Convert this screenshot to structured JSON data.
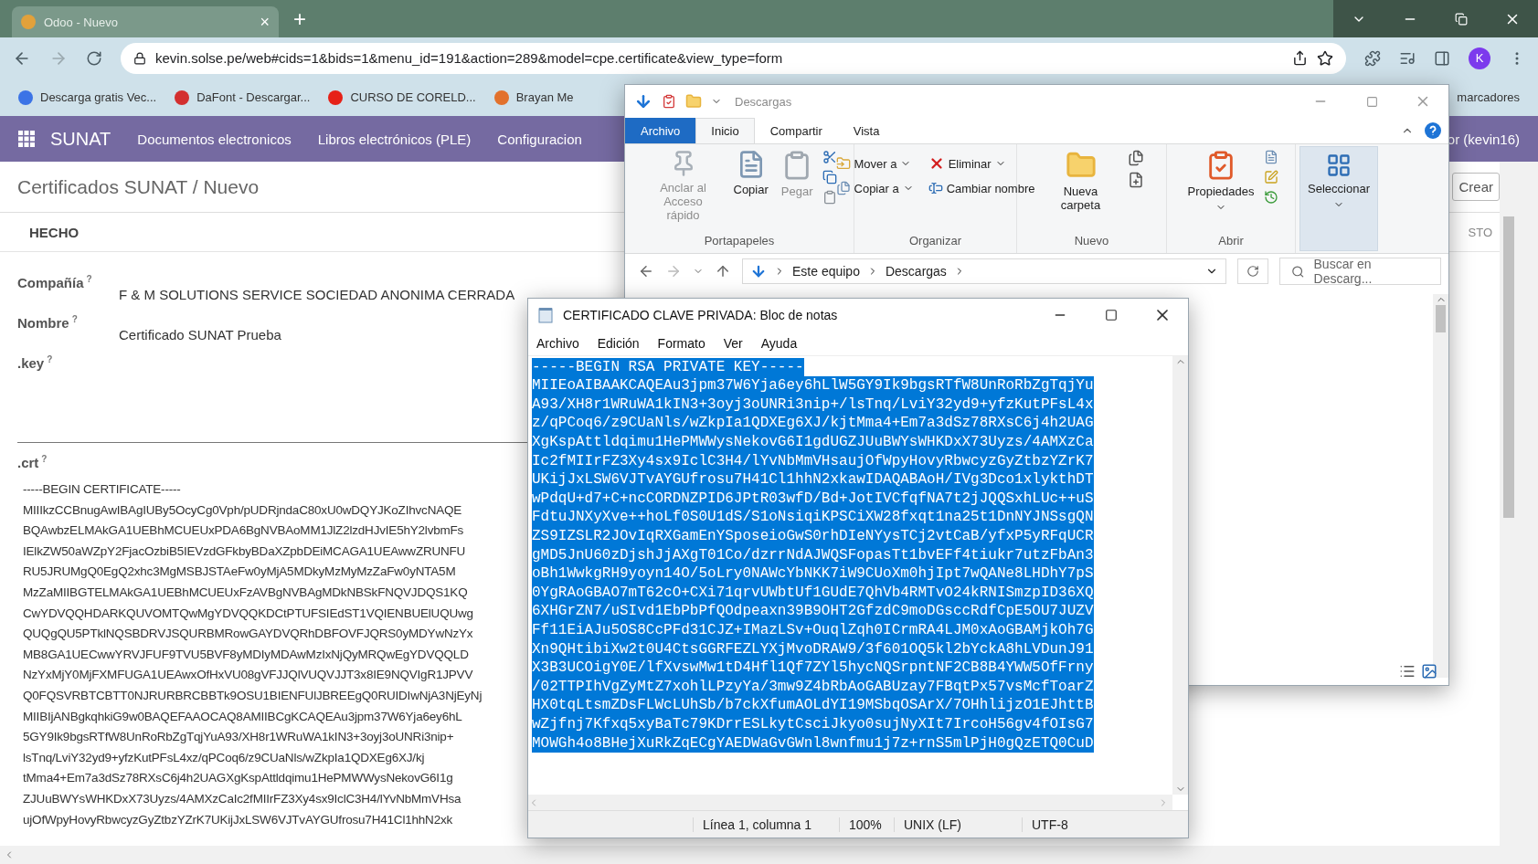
{
  "browser": {
    "tab_title": "Odoo - Nuevo",
    "tab_close": "×",
    "new_tab": "+",
    "url": "kevin.solse.pe/web#cids=1&bids=1&menu_id=191&action=289&model=cpe.certificate&view_type=form",
    "profile_initial": "K",
    "bookmarks": [
      {
        "label": "Descarga gratis Vec..."
      },
      {
        "label": "DaFont - Descargar..."
      },
      {
        "label": "CURSO DE CORELD..."
      },
      {
        "label": "Brayan Me"
      }
    ],
    "bookmarks_folder": "marcadores"
  },
  "odoo": {
    "app": "SUNAT",
    "menu": [
      "Documentos electronicos",
      "Libros electrónicos (PLE)",
      "Configuracion"
    ],
    "user": "or (kevin16)",
    "breadcrumb": "Certificados SUNAT / Nuevo",
    "create_button": "Crear",
    "status": "HECHO",
    "status_right": "STO",
    "fields": [
      {
        "label": "Compañía",
        "help": "?",
        "value": "F & M SOLUTIONS SERVICE SOCIEDAD ANONIMA CERRADA"
      },
      {
        "label": "Nombre",
        "help": "?",
        "value": "Certificado SUNAT Prueba"
      },
      {
        "label": ".key",
        "help": "?"
      }
    ],
    "crt": {
      "label": ".crt",
      "help": "?",
      "lines": [
        "-----BEGIN CERTIFICATE-----",
        "MIIIkzCCBnugAwIBAgIUBy5OcyCg0Vph/pUDRjndaC80xU0wDQYJKoZIhvcNAQE",
        "BQAwbzELMAkGA1UEBhMCUEUxPDA6BgNVBAoMM1JlZ2lzdHJvIE5hY2lvbmFs",
        "IElkZW50aWZpY2FjacOzbiB5IEVzdGFkbyBDaXZpbDEiMCAGA1UEAwwZRUNFU",
        "RU5JRUMgQ0EgQ2xhc3MgMSBJSTAeFw0yMjA5MDkyMzMyMzZaFw0yNTA5M",
        "MzZaMIIBGTELMAkGA1UEBhMCUEUxFzAVBgNVBAgMDkNBSkFNQVJDQS1KQ",
        "CwYDVQQHDARKQUVOMTQwMgYDVQQKDCtPTUFSIEdST1VQIENBUElUQUwg",
        "QUQgQU5PTklNQSBDRVJSQURBMRowGAYDVQRhDBFOVFJQRS0yMDYwNzYx",
        "MB8GA1UECwwYRVJFUF9TVU5BVF8yMDIyMDAwMzIxNjQyMRQwEgYDVQQLD",
        "NzYxMjY0MjFXMFUGA1UEAwxOfHxVU08gVFJJQlVUQVJJT3x8IE9NQVIgR1JPVV",
        "Q0FQSVRBTCBTT0NJRURBRCBBTk9OSU1BIENFUlJBREEgQ0RUIDIwNjA3NjEyNj",
        "MIIBIjANBgkqhkiG9w0BAQEFAAOCAQ8AMIIBCgKCAQEAu3jpm37W6Yja6ey6hL",
        "5GY9Ik9bgsRTfW8UnRoRbZgTqjYuA93/XH8r1WRuWA1kIN3+3oyj3oUNRi3nip+",
        "lsTnq/LviY32yd9+yfzKutPFsL4xz/qPCoq6/z9CUaNls/wZkpIa1QDXEg6XJ/kj",
        "tMma4+Em7a3dSz78RXsC6j4h2UAGXgKspAttldqimu1HePMWWysNekovG6I1g",
        "ZJUuBWYsWHKDxX73Uyzs/4AMXzCaIc2fMIIrFZ3Xy4sx9IclC3H4/lYvNbMmVHsa",
        "ujOfWpyHovyRbwcyzGyZtbzYZrK7UKijJxLSW6VJTvAYGUfrosu7H41Cl1hhN2xk"
      ]
    }
  },
  "explorer": {
    "title": "Descargas",
    "tabs": [
      {
        "label": "Archivo",
        "kind": "file",
        "selected": false
      },
      {
        "label": "Inicio",
        "kind": "tab",
        "selected": true
      },
      {
        "label": "Compartir",
        "kind": "tab",
        "selected": false
      },
      {
        "label": "Vista",
        "kind": "tab",
        "selected": false
      }
    ],
    "ribbon": [
      {
        "label": "Portapapeles",
        "items": [
          {
            "label": "Anclar al Acceso rápido",
            "disabled": true
          },
          {
            "label": "Copiar",
            "disabled": false
          },
          {
            "label": "Pegar",
            "disabled": true
          }
        ]
      },
      {
        "label": "Organizar",
        "items": [
          {
            "label": "Mover a"
          },
          {
            "label": "Copiar a"
          },
          {
            "label": "Eliminar"
          },
          {
            "label": "Cambiar nombre"
          }
        ]
      },
      {
        "label": "Nuevo",
        "items": [
          {
            "label": "Nueva carpeta"
          }
        ]
      },
      {
        "label": "Abrir",
        "items": [
          {
            "label": "Propiedades"
          }
        ]
      }
    ],
    "select_button": "Seleccionar",
    "path": [
      "Este equipo",
      "Descargas"
    ],
    "search_placeholder": "Buscar en Descarg..."
  },
  "notepad": {
    "title": "CERTIFICADO CLAVE PRIVADA: Bloc de notas",
    "menu": [
      "Archivo",
      "Edición",
      "Formato",
      "Ver",
      "Ayuda"
    ],
    "selected": true,
    "lines": [
      "-----BEGIN RSA PRIVATE KEY-----",
      "MIIEoAIBAAKCAQEAu3jpm37W6Yja6ey6hLlW5GY9Ik9bgsRTfW8UnRoRbZgTqjYu",
      "A93/XH8r1WRuWA1kIN3+3oyj3oUNRi3nip+/lsTnq/LviY32yd9+yfzKutPFsL4x",
      "z/qPCoq6/z9CUaNls/wZkpIa1QDXEg6XJ/kjtMma4+Em7a3dSz78RXsC6j4h2UAG",
      "XgKspAttldqimu1HePMWWysNekovG6I1gdUGZJUuBWYsWHKDxX73Uyzs/4AMXzCa",
      "Ic2fMIIrFZ3Xy4sx9IclC3H4/lYvNbMmVHsaujOfWpyHovyRbwcyzGyZtbzYZrK7",
      "UKijJxLSW6VJTvAYGUfrosu7H41Cl1hhN2xkawIDAQABAoH/IVg3Dco1xlykthDT",
      "wPdqU+d7+C+ncCORDNZPID6JPtR03wfD/Bd+JotIVCfqfNA7t2jJQQSxhLUc++uS",
      "FdtuJNXyXve++hoLf0S0U1dS/S1oNsiqiKPSCiXW28fxqt1na25t1DnNYJNSsgQN",
      "ZS9IZSLR2JOvIqRXGamEnYSposeioGwS0rhDIeNYysTCj2vtCaB/yfxP5yRFqUCR",
      "gMD5JnU60zDjshJjAXgT01Co/dzrrNdAJWQSFopasTt1bvEFf4tiukr7utzFbAn3",
      "oBh1WwkgRH9yoyn14O/5oLry0NAWcYbNKK7iW9CUoXm0hjIpt7wQANe8LHDhY7pS",
      "0YgRAoGBAO7mT62cO+CXi71qrvUWbtUf1GUdE7QhVb4RMTvO24kRNISmzpID36XQ",
      "6XHGrZN7/uSIvd1EbPbPfQOdpeaxn39B9OHT2GfzdC9moDGsccRdfCpE5OU7JUZV",
      "Ff11EiAJu5OS8CcPFd31CJZ+IMazLSv+OuqlZqh0ICrmRA4LJM0xAoGBAMjkOh7G",
      "Xn9QHtibiXw2t0U4CtsGGRFEZLYXjMvoDRAW9/3f601OQ5kl2bYckA8hLVDunJ91",
      "X3B3UCOigY0E/lfXvswMw1tD4Hfl1Qf7ZYl5hycNQSrpntNF2CB8B4YWW5OfFrny",
      "/02TTPIhVgZyMtZ7xohlLPzyYa/3mw9Z4bRbAoGABUzay7FBqtPx57vsMcfToarZ",
      "HX0tqLtsmZDsFLWcLUhSb/b7ckXfumAOLdYI19MSbqOSArX/7OHhlijzO1EJhttB",
      "wZjfnj7Kfxq5xyBaTc79KDrrESLkytCsciJkyo0sujNyXIt7IrcoH56gv4fOIsG7",
      "MOWGh4o8BHejXuRkZqECgYAEDWaGvGWnl8wnfmu1j7z+rnS5mlPjH0gQzETQ0CuD"
    ],
    "status": [
      "Línea 1, columna 1",
      "100%",
      "UNIX (LF)",
      "UTF-8"
    ]
  }
}
